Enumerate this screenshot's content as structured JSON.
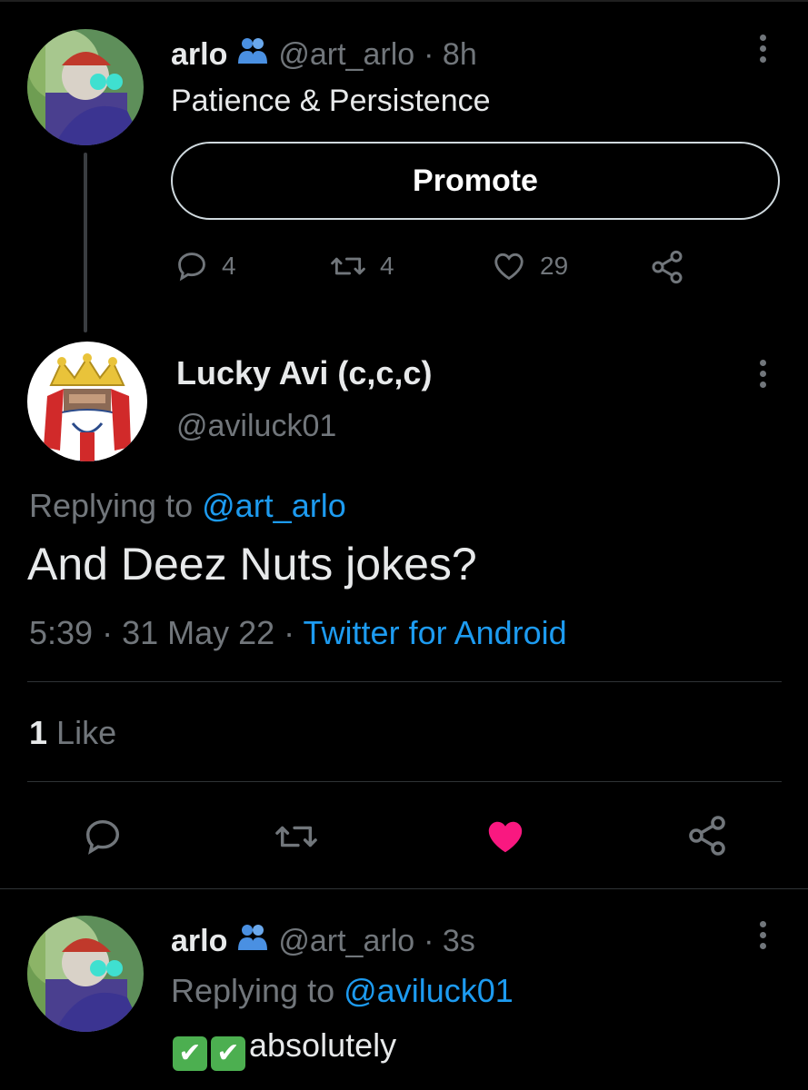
{
  "tweet1": {
    "display_name": "arlo",
    "handle": "@art_arlo",
    "time": "· 8h",
    "text": "Patience & Persistence",
    "promote_label": "Promote",
    "replies": "4",
    "retweets": "4",
    "likes": "29"
  },
  "main_tweet": {
    "display_name": "Lucky Avi (c,c,c)",
    "handle": "@aviluck01",
    "replying_prefix": "Replying to",
    "replying_handle": "@art_arlo",
    "text": "And Deez Nuts jokes?",
    "time": "5:39",
    "date": "· 31 May 22 ·",
    "source": "Twitter for Android",
    "like_count": "1",
    "like_label": "Like"
  },
  "reply": {
    "display_name": "arlo",
    "handle": "@art_arlo",
    "time": "· 3s",
    "replying_prefix": "Replying to",
    "replying_handle": "@aviluck01",
    "text": "absolutely",
    "emoji": [
      "✔",
      "✔"
    ]
  },
  "colors": {
    "background": "#000000",
    "accent_blue": "#1d9bf0",
    "like_pink": "#f91880",
    "muted": "#71767b"
  },
  "icons": [
    "reply-icon",
    "retweet-icon",
    "like-icon",
    "share-icon",
    "more-icon",
    "profile-group-icon",
    "check-emoji"
  ]
}
